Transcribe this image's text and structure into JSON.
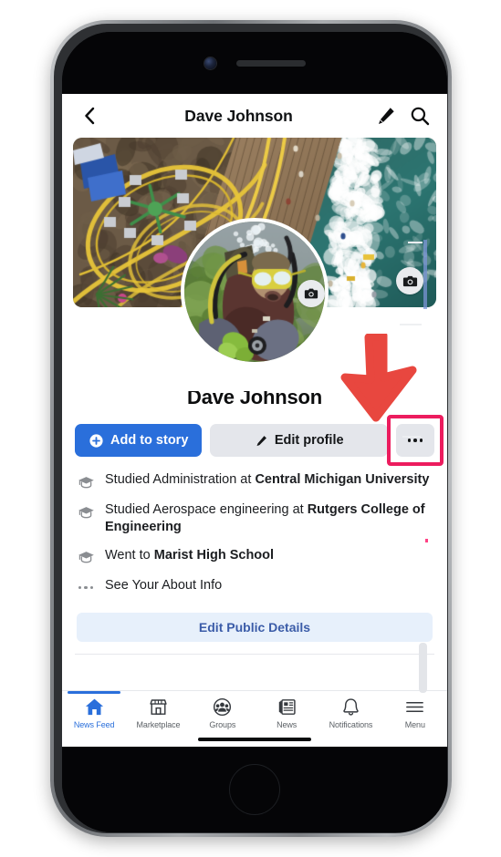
{
  "device": {
    "type": "iphone",
    "front_camera_icon": "front-camera",
    "earpiece_icon": "earpiece-speaker",
    "home_button_icon": "home-button"
  },
  "navbar": {
    "back_icon": "chevron-left-icon",
    "title": "Dave Johnson",
    "edit_icon": "pencil-icon",
    "search_icon": "search-icon"
  },
  "cover": {
    "description": "Aerial photo of a seaside pier with roller coaster and ocean surf",
    "camera_icon": "camera-icon"
  },
  "avatar": {
    "description": "Scuba diver underwater wearing yellow mask and green gloves",
    "camera_icon": "camera-icon"
  },
  "profile": {
    "name": "Dave Johnson"
  },
  "actions": {
    "add_to_story_label": "Add to story",
    "add_to_story_icon": "plus-circle-icon",
    "edit_profile_label": "Edit profile",
    "edit_profile_icon": "pencil-icon",
    "more_label": "",
    "more_icon": "ellipsis-icon"
  },
  "annotation": {
    "highlight_color": "#ec1c5e",
    "arrow_color": "#e8473f",
    "arrow_icon": "down-arrow-annotation",
    "target": "more-options-button"
  },
  "bio": {
    "items": [
      {
        "icon": "graduation-cap-icon",
        "prefix": "Studied Administration at ",
        "emphasis": "Central Michigan University",
        "suffix": ""
      },
      {
        "icon": "graduation-cap-icon",
        "prefix": "Studied Aerospace engineering at ",
        "emphasis": "Rutgers College of Engineering",
        "suffix": ""
      },
      {
        "icon": "graduation-cap-icon",
        "prefix": "Went to ",
        "emphasis": "Marist High School",
        "suffix": ""
      },
      {
        "icon": "ellipsis-icon",
        "prefix": "See Your About Info",
        "emphasis": "",
        "suffix": ""
      }
    ]
  },
  "edit_public_details": {
    "label": "Edit Public Details",
    "text_color": "#3b5ca8",
    "background_color": "#e7f0fb"
  },
  "tabbar": {
    "active_color": "#2a6fdb",
    "items": [
      {
        "label": "News Feed",
        "icon": "home-icon",
        "active": true
      },
      {
        "label": "Marketplace",
        "icon": "storefront-icon",
        "active": false
      },
      {
        "label": "Groups",
        "icon": "groups-icon",
        "active": false
      },
      {
        "label": "News",
        "icon": "newspaper-icon",
        "active": false
      },
      {
        "label": "Notifications",
        "icon": "bell-icon",
        "active": false
      },
      {
        "label": "Menu",
        "icon": "hamburger-menu-icon",
        "active": false
      }
    ]
  }
}
